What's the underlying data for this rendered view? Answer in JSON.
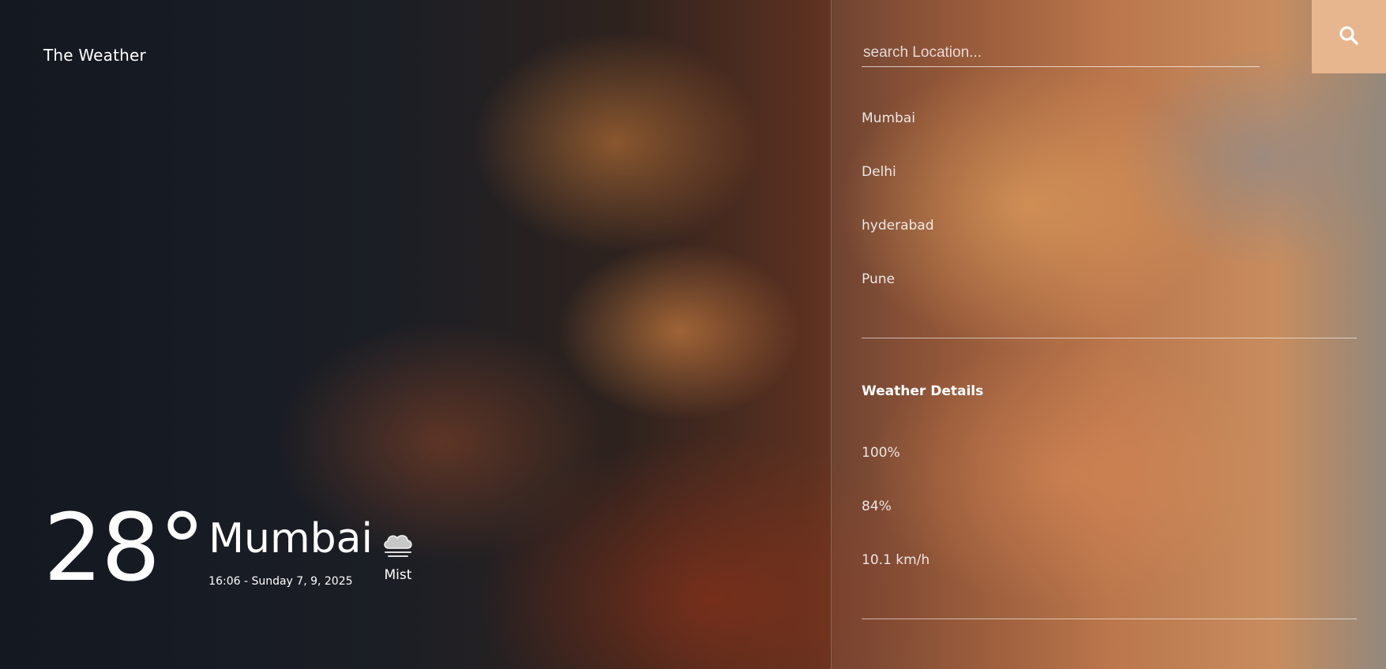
{
  "app": {
    "brand": "The Weather"
  },
  "current": {
    "temperature": "28°",
    "city": "Mumbai",
    "datetime": "16:06 - Sunday 7, 9, 2025",
    "condition": "Mist",
    "condition_icon": "cloud-mist-icon"
  },
  "search": {
    "placeholder": "search Location...",
    "value": "",
    "button_icon": "search-icon",
    "button_color": "#e7b58e"
  },
  "locations": [
    {
      "label": "Mumbai"
    },
    {
      "label": "Delhi"
    },
    {
      "label": "hyderabad"
    },
    {
      "label": "Pune"
    }
  ],
  "details": {
    "title": "Weather Details",
    "items": [
      {
        "value": "100%"
      },
      {
        "value": "84%"
      },
      {
        "value": "10.1 km/h"
      }
    ]
  }
}
